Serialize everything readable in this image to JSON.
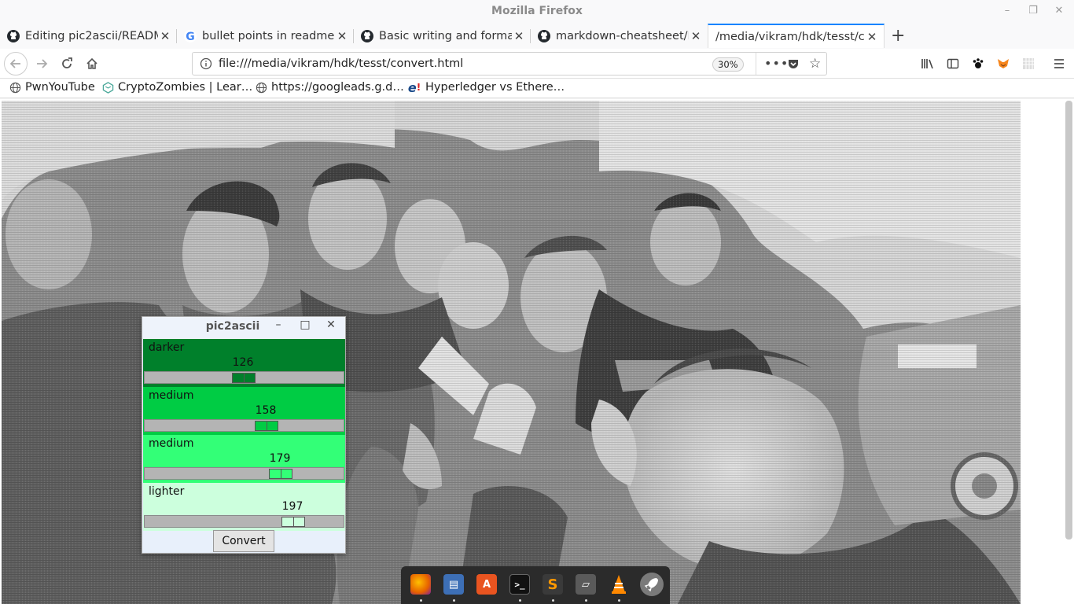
{
  "window": {
    "title": "Mozilla Firefox",
    "minimize": "–",
    "restore": "❐",
    "close": "✕"
  },
  "tabs": [
    {
      "label": "Editing pic2ascii/READM",
      "icon": "github-icon"
    },
    {
      "label": "bullet points in readme.r",
      "icon": "google-icon"
    },
    {
      "label": "Basic writing and format",
      "icon": "github-icon"
    },
    {
      "label": "markdown-cheatsheet/R",
      "icon": "github-icon"
    },
    {
      "label": "/media/vikram/hdk/tesst/c",
      "icon": "none",
      "active": true
    }
  ],
  "new_tab": "+",
  "urlbar": {
    "url": "file:///media/vikram/hdk/tesst/convert.html",
    "zoom": "30%"
  },
  "bookmarks": [
    {
      "label": "PwnYouTube",
      "icon": "globe-icon"
    },
    {
      "label": "CryptoZombies | Lear…",
      "icon": "cryptozombies-icon"
    },
    {
      "label": "https://googleads.g.d…",
      "icon": "globe-icon"
    },
    {
      "label": "Hyperledger vs Ethere…",
      "icon": "e-icon"
    }
  ],
  "app": {
    "title": "pic2ascii",
    "bands": [
      {
        "label": "darker",
        "value": "126",
        "fraction": 0.494,
        "color": "#00802b",
        "thumb": "#00802b"
      },
      {
        "label": "medium",
        "value": "158",
        "fraction": 0.62,
        "color": "#00cc44",
        "thumb": "#00cc44"
      },
      {
        "label": "medium",
        "value": "179",
        "fraction": 0.7,
        "color": "#33ff77",
        "thumb": "#33ff77"
      },
      {
        "label": "lighter",
        "value": "197",
        "fraction": 0.772,
        "color": "#ccffdd",
        "thumb": "#ccffdd"
      }
    ],
    "convert_label": "Convert"
  }
}
